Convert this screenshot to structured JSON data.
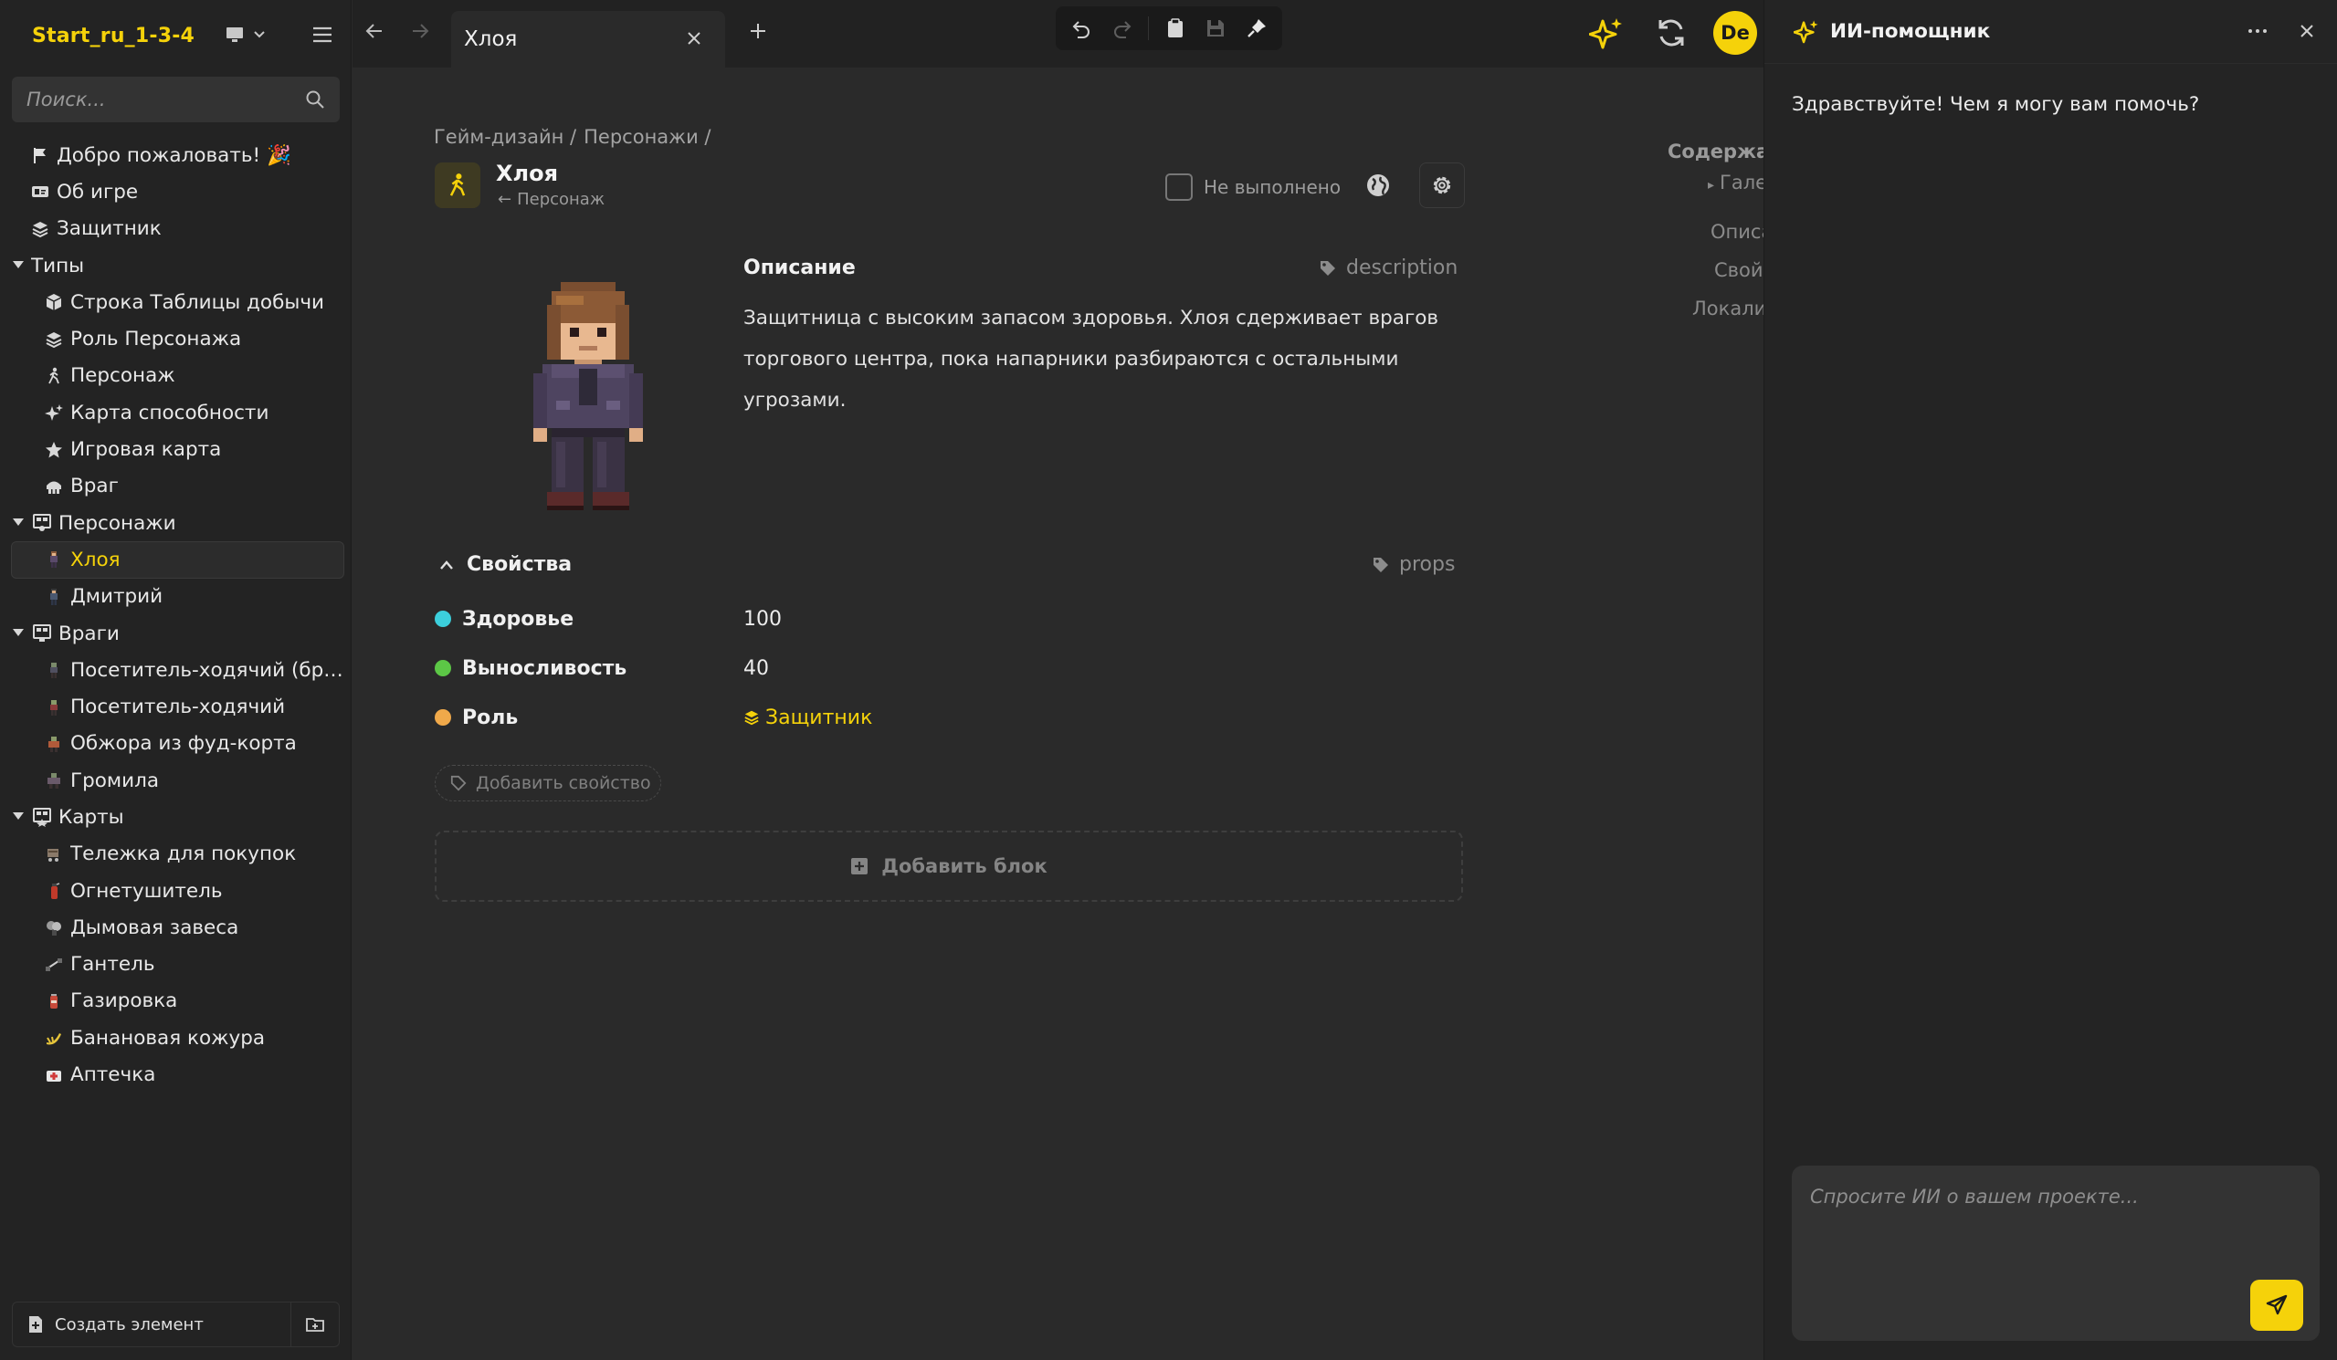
{
  "project": {
    "name": "Start_ru_1-3-4"
  },
  "search": {
    "placeholder": "Поиск..."
  },
  "sidebar": {
    "items": [
      {
        "label": "Добро пожаловать! 🎉",
        "icon": "flag-icon"
      },
      {
        "label": "Об игре",
        "icon": "id-card-icon"
      },
      {
        "label": "Защитник",
        "icon": "layers-icon"
      },
      {
        "label": "Типы",
        "icon": "folder-group"
      },
      {
        "label": "Строка Таблицы добычи",
        "icon": "cube-icon"
      },
      {
        "label": "Роль Персонажа",
        "icon": "layers-icon"
      },
      {
        "label": "Персонаж",
        "icon": "walking-person-icon"
      },
      {
        "label": "Карта способности",
        "icon": "sparkle-icon"
      },
      {
        "label": "Игровая карта",
        "icon": "star-icon"
      },
      {
        "label": "Враг",
        "icon": "skull-icon"
      },
      {
        "label": "Персонажи",
        "icon": "board-icon"
      },
      {
        "label": "Хлоя",
        "icon": "character-thumb-icon"
      },
      {
        "label": "Дмитрий",
        "icon": "character-thumb-icon"
      },
      {
        "label": "Враги",
        "icon": "board-icon"
      },
      {
        "label": "Посетитель-ходячий (бронированный)",
        "icon": "enemy-thumb-icon"
      },
      {
        "label": "Посетитель-ходячий",
        "icon": "enemy-thumb-icon"
      },
      {
        "label": "Обжора из фуд-корта",
        "icon": "enemy-thumb-icon"
      },
      {
        "label": "Громила",
        "icon": "enemy-thumb-icon"
      },
      {
        "label": "Карты",
        "icon": "board-icon"
      },
      {
        "label": "Тележка для покупок",
        "icon": "card-thumb-icon"
      },
      {
        "label": "Огнетушитель",
        "icon": "card-thumb-icon"
      },
      {
        "label": "Дымовая завеса",
        "icon": "card-thumb-icon"
      },
      {
        "label": "Гантель",
        "icon": "card-thumb-icon"
      },
      {
        "label": "Газировка",
        "icon": "card-thumb-icon"
      },
      {
        "label": "Банановая кожура",
        "icon": "card-thumb-icon"
      },
      {
        "label": "Аптечка",
        "icon": "card-thumb-icon"
      }
    ],
    "create_label": "Создать элемент"
  },
  "tabs": [
    {
      "label": "Хлоя"
    }
  ],
  "breadcrumb": {
    "a": "Гейм-дизайн /",
    "b": "Персонажи /"
  },
  "page": {
    "title": "Хлоя",
    "subtitle_arrow": "←",
    "subtitle": "Персонаж",
    "status": "Не выполнено"
  },
  "description": {
    "title": "Описание",
    "tag": "description",
    "text": "Защитница с высоким запасом здоровья. Хлоя сдерживает врагов торгового центра, пока напарники разбираются с остальными угрозами."
  },
  "properties": {
    "title": "Свойства",
    "tag": "props",
    "rows": [
      {
        "name": "Здоровье",
        "value": "100",
        "color": "#3ccfdc"
      },
      {
        "name": "Выносливость",
        "value": "40",
        "color": "#5cc746"
      },
      {
        "name": "Роль",
        "value": "Защитник",
        "color": "#f0a94a"
      }
    ],
    "add_label": "Добавить свойство"
  },
  "add_block_label": "Добавить блок",
  "toc": {
    "title": "Содержание",
    "items": [
      "Галерея",
      "Описание",
      "Свойства",
      "Локализация"
    ]
  },
  "ai": {
    "title": "ИИ-помощник",
    "greeting": "Здравствуйте! Чем я могу вам помочь?",
    "placeholder": "Спросите ИИ о вашем проекте..."
  },
  "user": {
    "initials": "De"
  },
  "colors": {
    "accent": "#f5d20a",
    "bg": "#2a2a2a",
    "sidebar": "#232323"
  }
}
